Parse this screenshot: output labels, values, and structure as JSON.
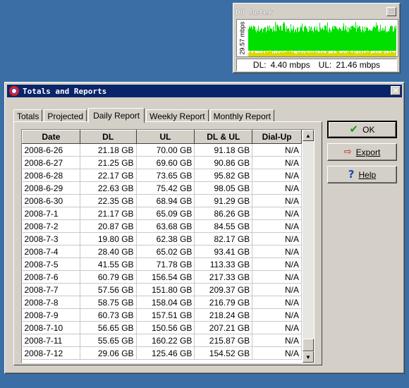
{
  "du_meter": {
    "title": "DU Meter",
    "scale_label": "29.57 mbps",
    "dl_label": "DL:",
    "dl_value": "4.40 mbps",
    "ul_label": "UL:",
    "ul_value": "21.46 mbps",
    "colors": {
      "download": "#d8d800",
      "upload": "#00e000"
    }
  },
  "main": {
    "title": "Totals and Reports",
    "tabs": [
      {
        "label": "Totals"
      },
      {
        "label": "Projected"
      },
      {
        "label": "Daily Report"
      },
      {
        "label": "Weekly Report"
      },
      {
        "label": "Monthly Report"
      }
    ],
    "active_tab": "Daily Report",
    "table": {
      "columns": [
        "Date",
        "DL",
        "UL",
        "DL & UL",
        "Dial-Up"
      ],
      "rows": [
        [
          "2008-6-26",
          "21.18 GB",
          "70.00 GB",
          "91.18 GB",
          "N/A"
        ],
        [
          "2008-6-27",
          "21.25 GB",
          "69.60 GB",
          "90.86 GB",
          "N/A"
        ],
        [
          "2008-6-28",
          "22.17 GB",
          "73.65 GB",
          "95.82 GB",
          "N/A"
        ],
        [
          "2008-6-29",
          "22.63 GB",
          "75.42 GB",
          "98.05 GB",
          "N/A"
        ],
        [
          "2008-6-30",
          "22.35 GB",
          "68.94 GB",
          "91.29 GB",
          "N/A"
        ],
        [
          "2008-7-1",
          "21.17 GB",
          "65.09 GB",
          "86.26 GB",
          "N/A"
        ],
        [
          "2008-7-2",
          "20.87 GB",
          "63.68 GB",
          "84.55 GB",
          "N/A"
        ],
        [
          "2008-7-3",
          "19.80 GB",
          "62.38 GB",
          "82.17 GB",
          "N/A"
        ],
        [
          "2008-7-4",
          "28.40 GB",
          "65.02 GB",
          "93.41 GB",
          "N/A"
        ],
        [
          "2008-7-5",
          "41.55 GB",
          "71.78 GB",
          "113.33 GB",
          "N/A"
        ],
        [
          "2008-7-6",
          "60.79 GB",
          "156.54 GB",
          "217.33 GB",
          "N/A"
        ],
        [
          "2008-7-7",
          "57.56 GB",
          "151.80 GB",
          "209.37 GB",
          "N/A"
        ],
        [
          "2008-7-8",
          "58.75 GB",
          "158.04 GB",
          "216.79 GB",
          "N/A"
        ],
        [
          "2008-7-9",
          "60.73 GB",
          "157.51 GB",
          "218.24 GB",
          "N/A"
        ],
        [
          "2008-7-10",
          "56.65 GB",
          "150.56 GB",
          "207.21 GB",
          "N/A"
        ],
        [
          "2008-7-11",
          "55.65 GB",
          "160.22 GB",
          "215.87 GB",
          "N/A"
        ],
        [
          "2008-7-12",
          "29.06 GB",
          "125.46 GB",
          "154.52 GB",
          "N/A"
        ]
      ]
    },
    "buttons": {
      "ok": {
        "label": "OK",
        "icon": "checkmark-icon"
      },
      "export": {
        "label": "Export",
        "icon": "export-icon"
      },
      "help": {
        "label": "Help",
        "icon": "help-icon"
      }
    }
  }
}
